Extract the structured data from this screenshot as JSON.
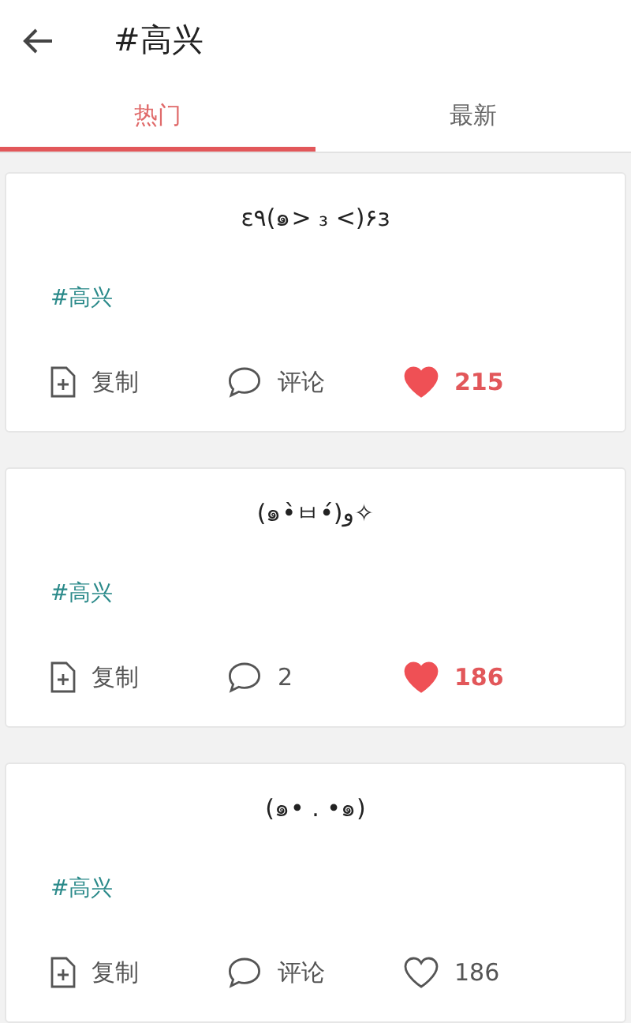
{
  "header": {
    "title": "#高兴"
  },
  "tabs": [
    {
      "label": "热门",
      "selected": true
    },
    {
      "label": "最新",
      "selected": false
    }
  ],
  "posts": [
    {
      "text": "ε٩(๑> ₃ <)۶з",
      "tag": "#高兴",
      "copy": "复制",
      "comment": "评论",
      "liked": true,
      "likes": "215"
    },
    {
      "text": "(๑•̀ㅂ•́)و✧",
      "tag": "#高兴",
      "copy": "复制",
      "comment": "2",
      "liked": true,
      "likes": "186"
    },
    {
      "text": "(๑• . •๑)",
      "tag": "#高兴",
      "copy": "复制",
      "comment": "评论",
      "liked": false,
      "likes": "186"
    }
  ]
}
